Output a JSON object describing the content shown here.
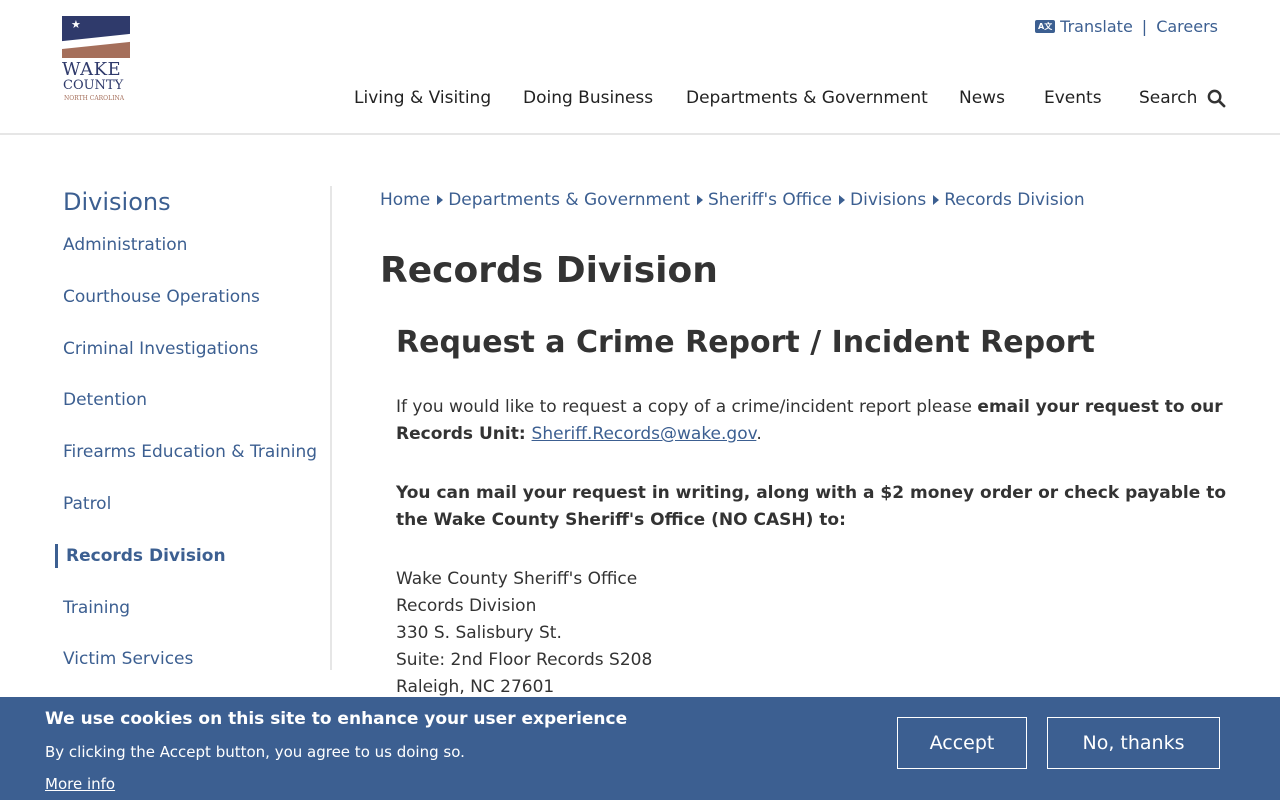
{
  "logo": {
    "line1": "WAKE",
    "line2": "COUNTY",
    "line3": "NORTH CAROLINA",
    "colors": {
      "navy": "#2f3a6b",
      "brown": "#a56f5b"
    }
  },
  "utility": {
    "translate_icon": "translate-icon",
    "translate_icon_text": "A文",
    "translate": "Translate",
    "separator": "|",
    "careers": "Careers"
  },
  "nav": {
    "items": [
      {
        "label": "Living & Visiting"
      },
      {
        "label": "Doing Business"
      },
      {
        "label": "Departments & Government"
      },
      {
        "label": "News"
      },
      {
        "label": "Events"
      },
      {
        "label": "Search",
        "icon": "search-icon"
      }
    ]
  },
  "sidebar": {
    "title": "Divisions",
    "items": [
      {
        "label": "Administration"
      },
      {
        "label": "Courthouse Operations"
      },
      {
        "label": "Criminal Investigations"
      },
      {
        "label": "Detention"
      },
      {
        "label": "Firearms Education & Training"
      },
      {
        "label": "Patrol"
      },
      {
        "label": "Records Division",
        "active": true
      },
      {
        "label": "Training"
      },
      {
        "label": "Victim Services"
      }
    ]
  },
  "breadcrumb": [
    "Home",
    "Departments & Government",
    "Sheriff's Office",
    "Divisions",
    "Records Division"
  ],
  "page": {
    "title": "Records Division",
    "section_title": "Request a Crime Report / Incident Report",
    "p1_plain": "If you would like to request a copy of a crime/incident report please ",
    "p1_bold": "email your request to our Records Unit: ",
    "p1_email": "Sheriff.Records@wake.gov",
    "p1_end": ".",
    "p2": "You can mail your request in writing, along with a $2 money order or check payable to the Wake County Sheriff's Office (NO CASH) to:",
    "address": [
      "Wake County Sheriff's Office",
      "Records Division",
      "330 S. Salisbury St.",
      "Suite: 2nd Floor Records S208",
      "Raleigh, NC 27601"
    ]
  },
  "cookie": {
    "title": "We use cookies on this site to enhance your user experience",
    "text": "By clicking the Accept button, you agree to us doing so.",
    "more_info": "More info",
    "accept": "Accept",
    "decline": "No, thanks"
  },
  "colors": {
    "accent": "#3c5f91",
    "text": "#333333",
    "cookie_bg": "#3c5f91"
  }
}
